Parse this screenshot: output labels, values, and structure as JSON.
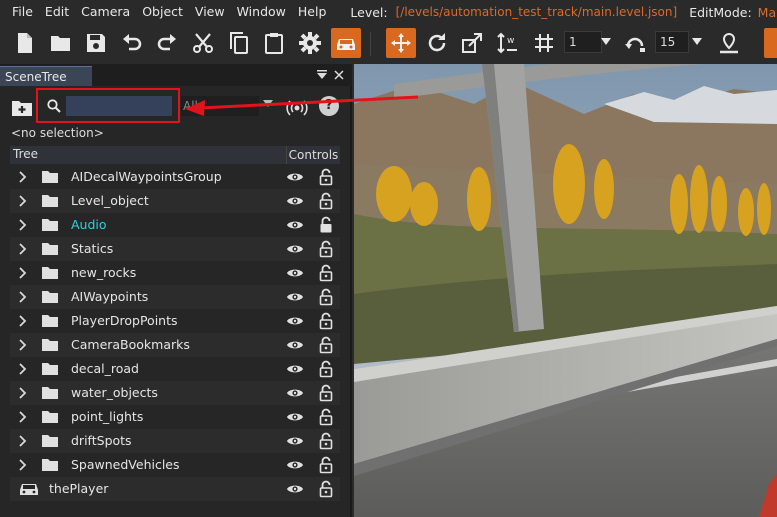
{
  "menu": {
    "items": [
      "File",
      "Edit",
      "Camera",
      "Object",
      "View",
      "Window",
      "Help"
    ],
    "level_label": "Level:",
    "level_path": "[/levels/automation_test_track/main.level.json]",
    "editmode_label": "EditMode:",
    "editmode_value": "Manipul"
  },
  "toolbar": {
    "icons": [
      "new-file-icon",
      "open-folder-icon",
      "save-icon",
      "undo-icon",
      "redo-icon",
      "cut-icon",
      "copy-icon",
      "paste-icon",
      "settings-gear-icon",
      "vehicle-icon",
      "move-gizmo-icon",
      "rotate-icon",
      "scale-icon",
      "width-icon",
      "grid-snap-icon",
      "rotate-snap-icon",
      "ground-snap-icon"
    ],
    "grid_value": "1",
    "rotate_value": "15",
    "accent": "#d9691f"
  },
  "scenetree": {
    "tab_label": "SceneTree",
    "search_value": "",
    "filter_value": "All",
    "no_selection": "<no selection>",
    "col_tree": "Tree",
    "col_controls": "Controls",
    "items": [
      {
        "name": "AIDecalWaypointsGroup",
        "type": "folder"
      },
      {
        "name": "Level_object",
        "type": "folder"
      },
      {
        "name": "Audio",
        "type": "folder",
        "highlight": true
      },
      {
        "name": "Statics",
        "type": "folder"
      },
      {
        "name": "new_rocks",
        "type": "folder"
      },
      {
        "name": "AIWaypoints",
        "type": "folder"
      },
      {
        "name": "PlayerDropPoints",
        "type": "folder"
      },
      {
        "name": "CameraBookmarks",
        "type": "folder"
      },
      {
        "name": "decal_road",
        "type": "folder"
      },
      {
        "name": "water_objects",
        "type": "folder"
      },
      {
        "name": "point_lights",
        "type": "folder"
      },
      {
        "name": "driftSpots",
        "type": "folder"
      },
      {
        "name": "SpawnedVehicles",
        "type": "folder"
      },
      {
        "name": "thePlayer",
        "type": "vehicle"
      }
    ],
    "highlight_color": "#2fd0e0"
  },
  "annotation": {
    "box_color": "#e3131b",
    "arrow_color": "#e3131b"
  }
}
